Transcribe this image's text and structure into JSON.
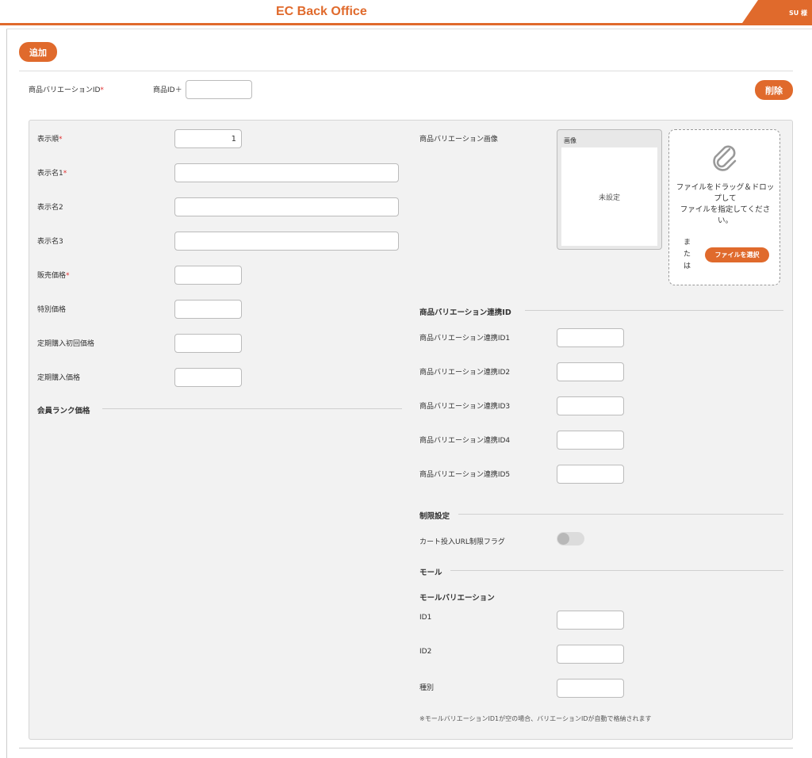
{
  "header": {
    "app_title": "EC Back Office",
    "user_label": "SU 様"
  },
  "toolbar": {
    "add_label": "追加",
    "delete_label": "削除"
  },
  "variation_id": {
    "label": "商品バリエーションID",
    "required_mark": "*",
    "prefix_label": "商品ID＋",
    "value": ""
  },
  "left_form": {
    "display_order": {
      "label": "表示順",
      "required_mark": "*",
      "value": "1"
    },
    "display_name1": {
      "label": "表示名1",
      "required_mark": "*",
      "value": ""
    },
    "display_name2": {
      "label": "表示名2",
      "value": ""
    },
    "display_name3": {
      "label": "表示名3",
      "value": ""
    },
    "sale_price": {
      "label": "販売価格",
      "required_mark": "*",
      "value": ""
    },
    "special_price": {
      "label": "特別価格",
      "value": ""
    },
    "subscription_first_price": {
      "label": "定期購入初回価格",
      "value": ""
    },
    "subscription_price": {
      "label": "定期購入価格",
      "value": ""
    },
    "member_rank_section": "会員ランク価格"
  },
  "image_area": {
    "label": "商品バリエーション画像",
    "box_header": "画像",
    "unset_text": "未設定",
    "drop_text": "ファイルをドラッグ＆ドロップして\nファイルを指定してください。",
    "or_text": "または",
    "select_button": "ファイルを選択",
    "icon": "paperclip-icon"
  },
  "link_ids": {
    "section": "商品バリエーション連携ID",
    "items": [
      {
        "label": "商品バリエーション連携ID1",
        "value": ""
      },
      {
        "label": "商品バリエーション連携ID2",
        "value": ""
      },
      {
        "label": "商品バリエーション連携ID3",
        "value": ""
      },
      {
        "label": "商品バリエーション連携ID4",
        "value": ""
      },
      {
        "label": "商品バリエーション連携ID5",
        "value": ""
      }
    ]
  },
  "restriction": {
    "section": "制限設定",
    "cart_url_flag_label": "カート投入URL制限フラグ",
    "cart_url_flag_on": false
  },
  "mall": {
    "section": "モール",
    "sub_section": "モールバリエーション",
    "id1": {
      "label": "ID1",
      "value": ""
    },
    "id2": {
      "label": "ID2",
      "value": ""
    },
    "kind": {
      "label": "種別",
      "value": ""
    },
    "note": "※モールバリエーションID1が空の場合、バリエーションIDが自動で格納されます"
  },
  "colors": {
    "accent": "#e06a2c",
    "required": "#e03030",
    "panel_bg": "#f2f2f2"
  }
}
